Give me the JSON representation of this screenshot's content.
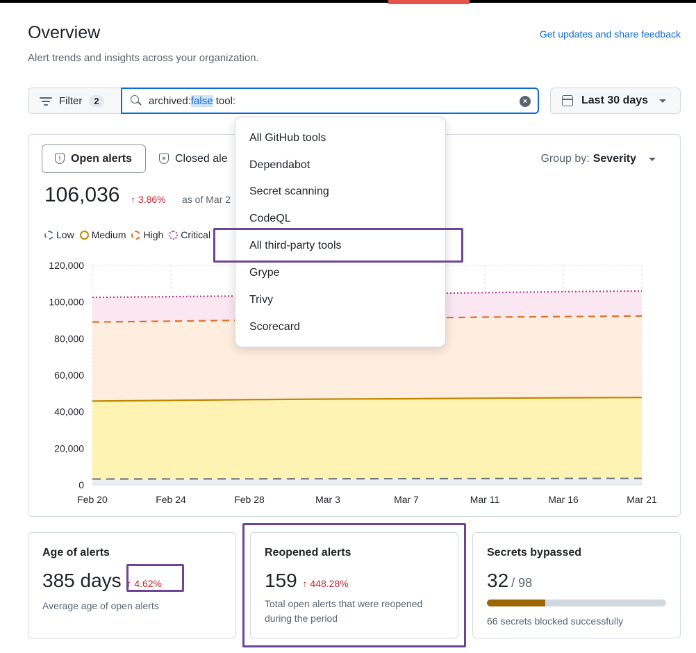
{
  "header": {
    "title": "Overview",
    "subtitle": "Alert trends and insights across your organization.",
    "feedback_link": "Get updates and share feedback"
  },
  "filter_bar": {
    "filter_label": "Filter",
    "filter_count": "2",
    "query_prefix": "archived:",
    "query_highlight": "false",
    "query_suffix": " tool:",
    "date_range": "Last 30 days"
  },
  "panel": {
    "tabs": [
      {
        "label": "Open alerts",
        "icon": "shield-alert-icon",
        "selected": true
      },
      {
        "label": "Closed ale",
        "icon": "shield-x-icon",
        "selected": false
      }
    ],
    "group_by_label": "Group by:",
    "group_by_value": "Severity",
    "total": "106,036",
    "delta": "↑ 3.86%",
    "as_of": "as of Mar 2",
    "legend": [
      {
        "label": "Low",
        "color": "#6e7781"
      },
      {
        "label": "Medium",
        "color": "#bf8700"
      },
      {
        "label": "High",
        "color": "#e16f24"
      },
      {
        "label": "Critical",
        "color": "#bf3989"
      }
    ]
  },
  "tool_menu": {
    "items": [
      "All GitHub tools",
      "Dependabot",
      "Secret scanning",
      "CodeQL",
      "All third-party tools",
      "Grype",
      "Trivy",
      "Scorecard"
    ],
    "highlighted_item": "All third-party tools"
  },
  "chart_data": {
    "type": "area",
    "x": [
      "Feb 20",
      "Feb 24",
      "Feb 28",
      "Mar 3",
      "Mar 7",
      "Mar 11",
      "Mar 16",
      "Mar 21"
    ],
    "ylim": [
      0,
      120000
    ],
    "yticks": [
      "0",
      "20,000",
      "40,000",
      "60,000",
      "80,000",
      "100,000",
      "120,000"
    ],
    "grid": true,
    "stacked": true,
    "series": [
      {
        "name": "Low",
        "color": "#6e7781",
        "values": [
          3200,
          3250,
          3300,
          3350,
          3400,
          3450,
          3500,
          3550
        ]
      },
      {
        "name": "Medium",
        "color": "#bf8700",
        "values": [
          45800,
          46200,
          46600,
          46900,
          47100,
          47400,
          47600,
          47800
        ]
      },
      {
        "name": "High",
        "color": "#e16f24",
        "values": [
          89000,
          89500,
          90000,
          90700,
          91200,
          91700,
          92000,
          92300
        ]
      },
      {
        "name": "Critical",
        "color": "#bf3989",
        "values": [
          102500,
          102900,
          103300,
          103900,
          104500,
          105100,
          105600,
          106036
        ]
      }
    ]
  },
  "cards": [
    {
      "title": "Age of alerts",
      "value": "385 days",
      "delta": "↑ 4.62%",
      "description": "Average age of open alerts"
    },
    {
      "title": "Reopened alerts",
      "value": "159",
      "delta": "↑ 448.28%",
      "description_line1": "Total open alerts that were reopened",
      "description_line2": "during the period"
    },
    {
      "title": "Secrets bypassed",
      "value": "32",
      "total": "/ 98",
      "progress": 0.327,
      "description": "66 secrets blocked successfully"
    }
  ]
}
